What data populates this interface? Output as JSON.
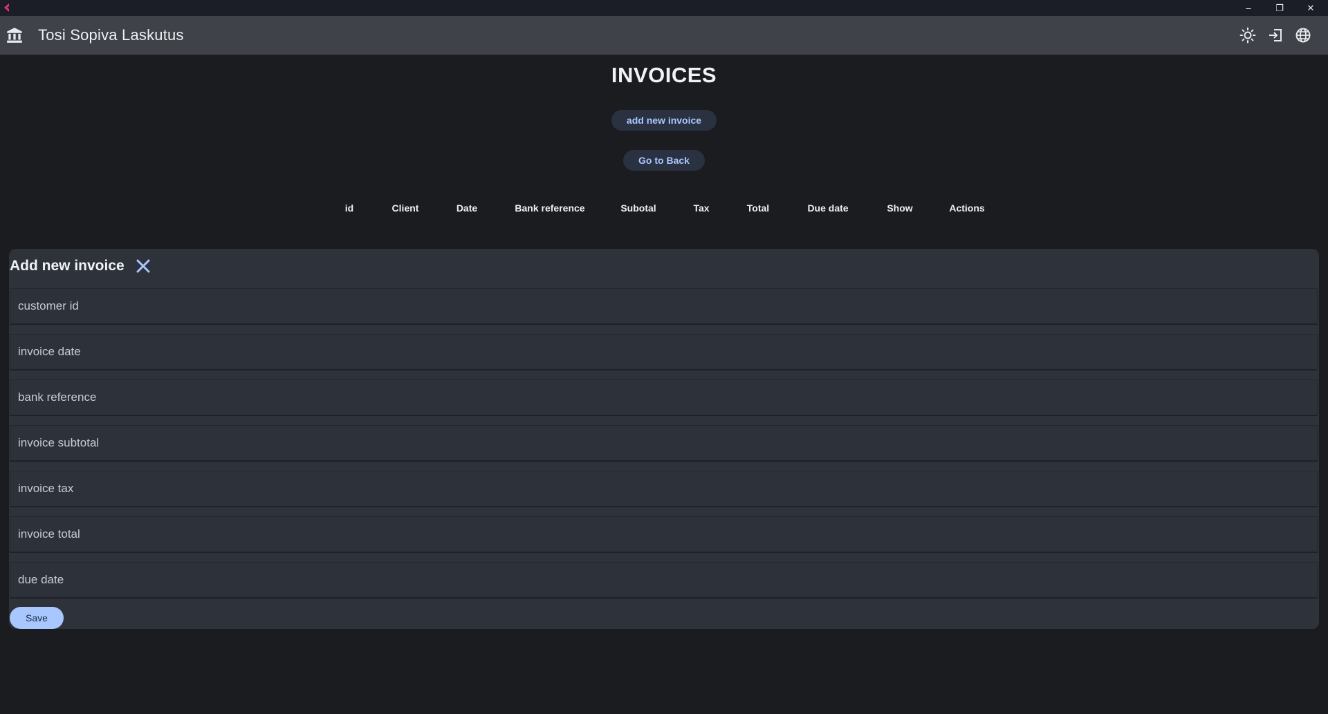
{
  "window": {
    "minimize": "–",
    "restore": "❐",
    "close": "✕"
  },
  "appbar": {
    "title": "Tosi Sopiva Laskutus",
    "icons": [
      "bank-icon",
      "brightness-icon",
      "logout-icon",
      "language-icon"
    ]
  },
  "page": {
    "title": "INVOICES",
    "add_button": "add new invoice",
    "back_button": "Go to Back"
  },
  "table": {
    "columns": [
      "id",
      "Client",
      "Date",
      "Bank reference",
      "Subotal",
      "Tax",
      "Total",
      "Due date",
      "Show",
      "Actions"
    ]
  },
  "dialog": {
    "title": "Add new invoice",
    "fields": [
      {
        "placeholder": "customer id",
        "value": ""
      },
      {
        "placeholder": "invoice date",
        "value": ""
      },
      {
        "placeholder": "bank reference",
        "value": ""
      },
      {
        "placeholder": "invoice subtotal",
        "value": ""
      },
      {
        "placeholder": "invoice tax",
        "value": ""
      },
      {
        "placeholder": "invoice total",
        "value": ""
      },
      {
        "placeholder": "due date",
        "value": ""
      }
    ],
    "save_label": "Save"
  },
  "colors": {
    "background": "#1b1c1f",
    "appbar": "#3f4249",
    "accent": "#a9c7ff",
    "dialog": "#2e323a"
  }
}
